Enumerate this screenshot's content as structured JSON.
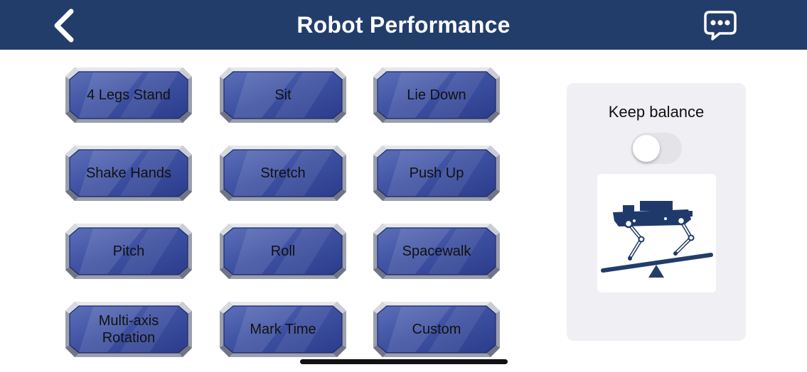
{
  "header": {
    "title": "Robot Performance",
    "back_icon": "chevron-left-icon",
    "chat_icon": "chat-bubble-icon"
  },
  "actions": [
    {
      "label": "4 Legs Stand"
    },
    {
      "label": "Sit"
    },
    {
      "label": "Lie Down"
    },
    {
      "label": "Shake Hands"
    },
    {
      "label": "Stretch"
    },
    {
      "label": "Push Up"
    },
    {
      "label": "Pitch"
    },
    {
      "label": "Roll"
    },
    {
      "label": "Spacewalk"
    },
    {
      "label": "Multi-axis\nRotation"
    },
    {
      "label": "Mark Time"
    },
    {
      "label": "Custom"
    }
  ],
  "balance": {
    "label": "Keep balance",
    "enabled": false
  },
  "colors": {
    "header": "#233d6b",
    "button": "#35479a",
    "panel": "#f0f0f4"
  }
}
